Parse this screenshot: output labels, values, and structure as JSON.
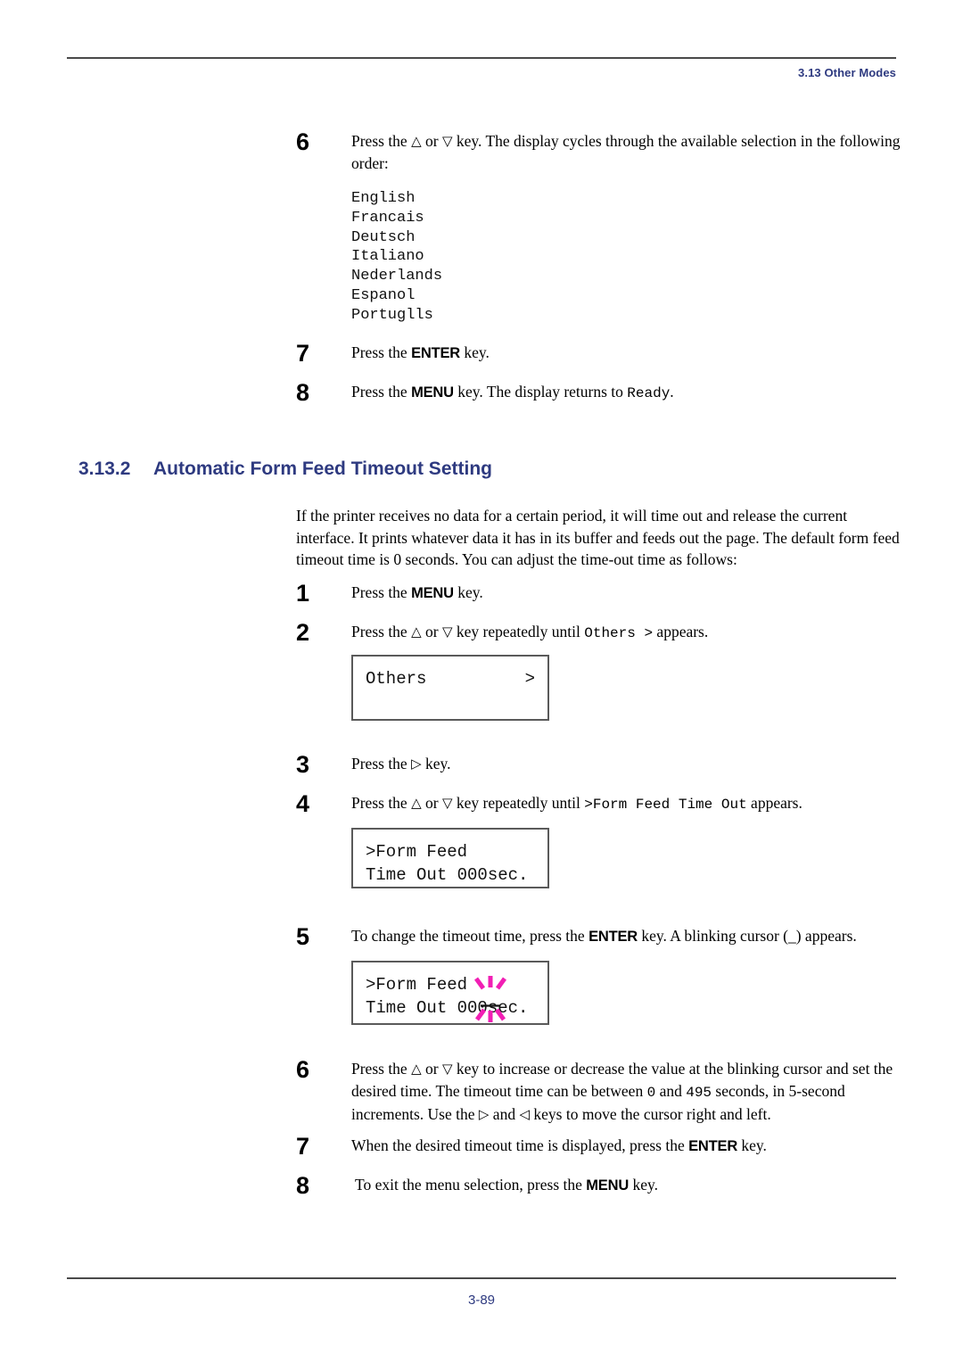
{
  "header": {
    "running_head": "3.13 Other Modes"
  },
  "footer": {
    "page_number": "3-89"
  },
  "top_steps": [
    {
      "num": "6",
      "text_1": "Press the ",
      "tri_up": "△",
      "text_2": " or ",
      "tri_down": "▽",
      "text_3": " key. The display cycles through the available selection in the following order:"
    },
    {
      "num": "7",
      "text_1": "Press the ",
      "key": "ENTER",
      "text_2": " key."
    },
    {
      "num": "8",
      "text_1": "Press the ",
      "key": "MENU",
      "text_2": " key. The display returns to ",
      "mono": "Ready",
      "text_3": "."
    }
  ],
  "languages": [
    "English",
    "Francais",
    "Deutsch",
    "Italiano",
    "Nederlands",
    "Espanol",
    "Portuglls"
  ],
  "section": {
    "number": "3.13.2",
    "title": "Automatic Form Feed Timeout Setting",
    "color": "#2e3a80"
  },
  "intro_paragraph": "If the printer receives no data for a certain period, it will time out and release the current interface. It prints whatever data it has in its buffer and feeds out the page. The default form feed timeout time is 0 seconds. You can adjust the time-out time as follows:",
  "procedure": {
    "step1": {
      "num": "1",
      "text_1": "Press the ",
      "key": "MENU",
      "text_2": " key."
    },
    "step2": {
      "num": "2",
      "text_1": "Press the ",
      "tri_up": "△",
      "text_2": " or ",
      "tri_down": "▽",
      "text_3": " key repeatedly until ",
      "mono": "Others  >",
      "text_4": " appears."
    },
    "step3": {
      "num": "3",
      "text_1": "Press the ",
      "tri_right": "▷",
      "text_2": " key."
    },
    "step4": {
      "num": "4",
      "text_1": "Press the ",
      "tri_up": "△",
      "text_2": " or ",
      "tri_down": "▽",
      "text_3": " key repeatedly until ",
      "mono": ">Form Feed Time Out",
      "text_4": " appears."
    },
    "step5": {
      "num": "5",
      "text_1": "To change the timeout time, press the ",
      "key": "ENTER",
      "text_2": " key. A blinking cursor (_) appears."
    },
    "step6": {
      "num": "6",
      "text_1": "Press the ",
      "tri_up": "△",
      "text_2": " or ",
      "tri_down": "▽",
      "text_3": " key to increase or decrease the value at the blinking cursor and set the desired time. The timeout time can be between ",
      "mono_min": "0",
      "text_4": " and ",
      "mono_max": "495",
      "text_5": " seconds, in 5-second increments. Use the ",
      "tri_right": "▷",
      "text_6": " and ",
      "tri_left": "◁",
      "text_7": " keys to move the cursor right and left."
    },
    "step7": {
      "num": "7",
      "text_1": "When the desired timeout time is displayed, press the ",
      "key": "ENTER",
      "text_2": " key."
    },
    "step8": {
      "num": "8",
      "text_1": "To exit the menu selection, press the ",
      "key": "MENU",
      "text_2": " key."
    }
  },
  "lcd_panels": {
    "others": {
      "line1_left": "Others",
      "line1_right": ">",
      "line2": ""
    },
    "form_feed": {
      "line1": ">Form Feed",
      "line2": "Time Out 000sec."
    },
    "form_feed_cursor": {
      "line1": ">Form Feed",
      "line2": "Time Out 000sec.",
      "cursor_color": "#F11FB4",
      "cursor_glyph": "blinking-cursor-sparkle"
    }
  }
}
